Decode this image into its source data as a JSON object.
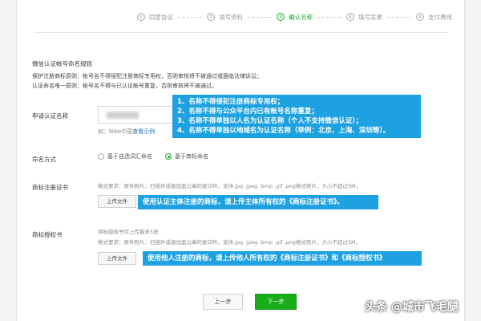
{
  "steps": [
    {
      "num": "①",
      "label": "同意协议",
      "active": false
    },
    {
      "num": "②",
      "label": "填写资料",
      "active": false
    },
    {
      "num": "③",
      "label": "确认名称",
      "active": true
    },
    {
      "num": "④",
      "label": "填写发票",
      "active": false
    },
    {
      "num": "⑤",
      "label": "支付费用",
      "active": false
    }
  ],
  "rules": {
    "title": "微信认证帐号命名规则",
    "lines": [
      "保护注册商标原则：帐号名不得侵犯注册商标专用权，否则审核将不被通过或面临法律诉讼；",
      "认证命名唯一原则：帐号名不得与已认证帐号重复，否则审核将不被通过。"
    ]
  },
  "form": {
    "name_label": "申请认证名称",
    "example_prefix": "如：Nike中国",
    "example_link": "查看示例",
    "naming_label": "命名方式",
    "naming_options": [
      "基于自选词汇命名",
      "基于商标命名"
    ],
    "naming_selected": 1,
    "trademark_label": "商标注册证书",
    "trademark_hint": "格式要求：原件照片、扫描件或者加盖公章的复印件，支持.jpg .jpeg .bmp .gif .png格式照片，大小不超过5M。",
    "upload_label": "上传文件",
    "authorization_label": "商标授权书",
    "authorization_hint_1": "商标授权书可上传最多5张",
    "authorization_hint_2": "格式要求：原件照片、扫描件或者加盖公章的复印件，支持.jpg .jpeg .bmp .gif .png格式照片，大小不超过5M。"
  },
  "callouts": {
    "rules_box": [
      "1、名称不得侵犯注册商标专用权；",
      "2、名称不得与公众平台内已有帐号名称重复；",
      "3、名称不得单独以人名为认证名称（个人不支持微信认证）；",
      "4、名称不得单独以地域名为认证名称（举例：北京、上海、深圳等）。"
    ],
    "trademark_box": "使用认证主体注册的商标，请上传主体所有权的《商标注册证书》。",
    "authorization_box": "使用他人注册的商标，请上传他人所有权的《商标注册证书》和《商标授权书》"
  },
  "buttons": {
    "prev": "上一步",
    "next": "下一步"
  },
  "watermark": "头条 @城市飞毛腿",
  "colors": {
    "accent_green": "#1aad19",
    "callout_blue": "#1da1e0",
    "link_blue": "#2d6fb4"
  }
}
